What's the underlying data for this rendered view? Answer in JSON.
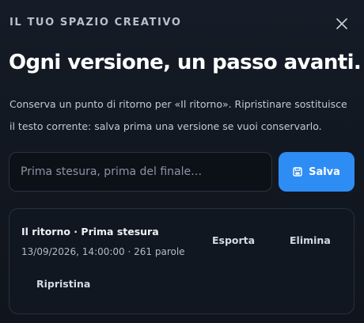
{
  "header": {
    "eyebrow": "IL TUO SPAZIO CREATIVO",
    "close_icon": "close-icon"
  },
  "main": {
    "title": "Ogni versione, un passo avanti.",
    "description": "Conserva un punto di ritorno per «Il ritorno». Ripristinare sostituisce il testo corrente: salva prima una versione se vuoi conservarlo."
  },
  "form": {
    "placeholder": "Prima stesura, prima del finale…",
    "value": "",
    "save_label": "Salva",
    "save_icon": "save-icon"
  },
  "versions": [
    {
      "title": "Il ritorno · Prima stesura",
      "meta": "13/09/2026, 14:00:00 · 261 parole",
      "export_label": "Esporta",
      "delete_label": "Elimina",
      "restore_label": "Ripristina"
    }
  ],
  "colors": {
    "accent": "#2e8cf5",
    "background": "#121821"
  }
}
